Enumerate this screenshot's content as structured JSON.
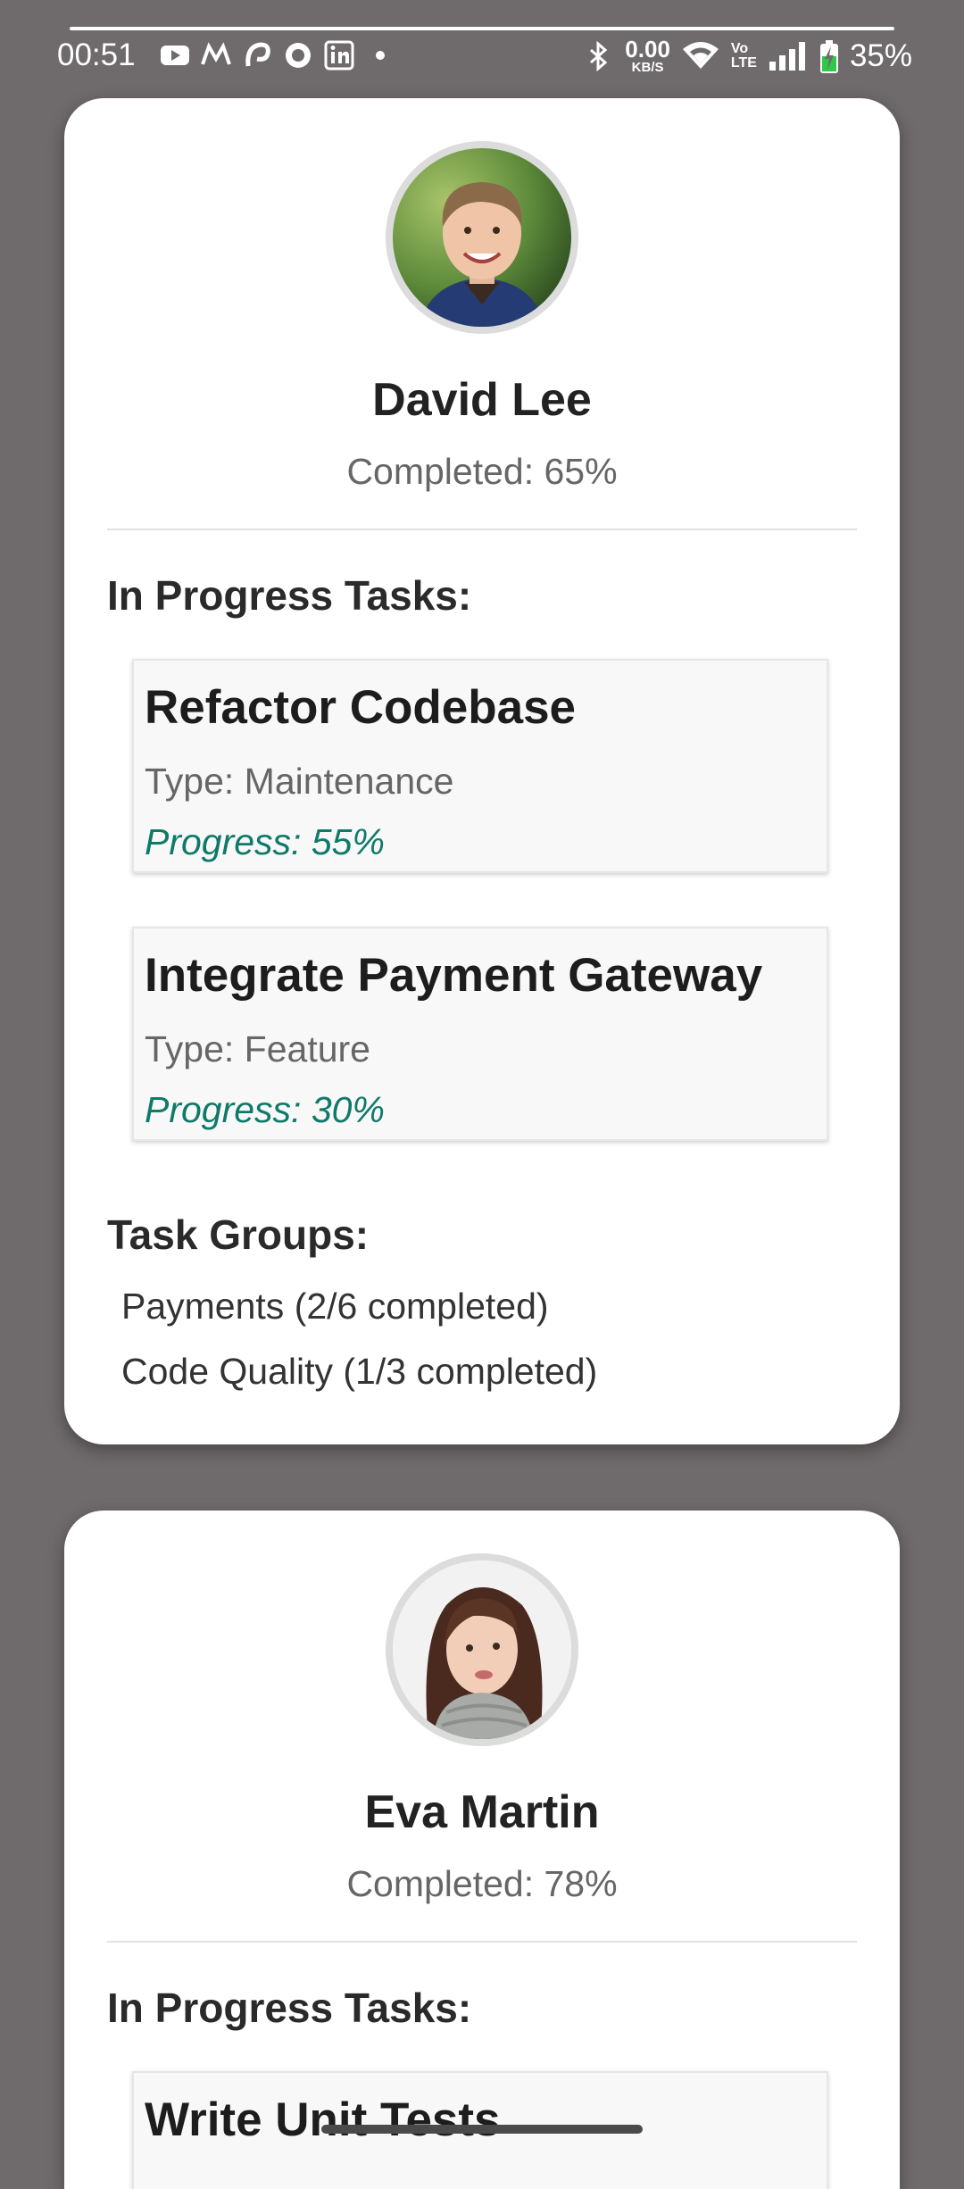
{
  "status_bar": {
    "time": "00:51",
    "left_icons": [
      "youtube-icon",
      "m-app-icon",
      "swirl-app-icon",
      "circle-app-icon",
      "linkedin-icon",
      "dot-icon"
    ],
    "net_speed_value": "0.00",
    "net_speed_unit": "KB/S",
    "volte_top": "Vo",
    "volte_bottom": "LTE",
    "battery_percent": "35%",
    "colors": {
      "text": "#ffffff",
      "battery_charge": "#2ec94a"
    }
  },
  "people": [
    {
      "name": "David Lee",
      "completed": "Completed: 65%",
      "in_progress_title": "In Progress Tasks:",
      "tasks": [
        {
          "name": "Refactor Codebase",
          "type": "Type: Maintenance",
          "progress": "Progress: 55%"
        },
        {
          "name": "Integrate Payment Gateway",
          "type": "Type: Feature",
          "progress": "Progress: 30%"
        }
      ],
      "groups_title": "Task Groups:",
      "groups": [
        "Payments (2/6 completed)",
        "Code Quality (1/3 completed)"
      ]
    },
    {
      "name": "Eva Martin",
      "completed": "Completed: 78%",
      "in_progress_title": "In Progress Tasks:",
      "tasks": [
        {
          "name": "Write Unit Tests"
        }
      ]
    }
  ],
  "colors": {
    "background": "#6f6a6b",
    "card": "#ffffff",
    "progress_text": "#0f7a6a",
    "muted_text": "#666666"
  }
}
